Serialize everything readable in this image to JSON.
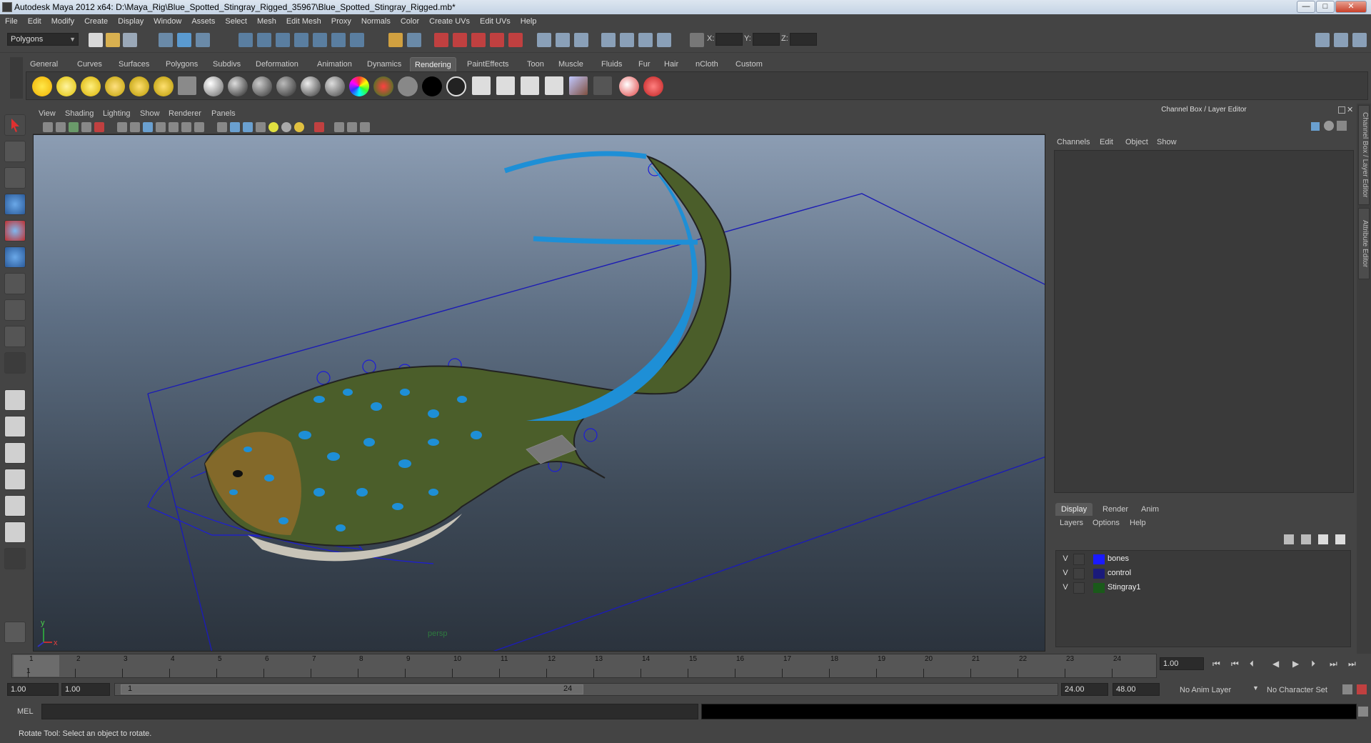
{
  "window": {
    "title": "Autodesk Maya 2012 x64: D:\\Maya_Rig\\Blue_Spotted_Stingray_Rigged_35967\\Blue_Spotted_Stingray_Rigged.mb*",
    "min": "—",
    "max": "□",
    "close": "✕"
  },
  "menubar": [
    "File",
    "Edit",
    "Modify",
    "Create",
    "Display",
    "Window",
    "Assets",
    "Select",
    "Mesh",
    "Edit Mesh",
    "Proxy",
    "Normals",
    "Color",
    "Create UVs",
    "Edit UVs",
    "Help"
  ],
  "toolbar": {
    "mode": "Polygons",
    "x_label": "X:",
    "y_label": "Y:",
    "z_label": "Z:"
  },
  "shelf_tabs": [
    "General",
    "Curves",
    "Surfaces",
    "Polygons",
    "Subdivs",
    "Deformation",
    "Animation",
    "Dynamics",
    "Rendering",
    "PaintEffects",
    "Toon",
    "Muscle",
    "Fluids",
    "Fur",
    "Hair",
    "nCloth",
    "Custom"
  ],
  "shelf_active": "Rendering",
  "viewport": {
    "menu": [
      "View",
      "Shading",
      "Lighting",
      "Show",
      "Renderer",
      "Panels"
    ],
    "camera_label": "persp",
    "axis_y": "y",
    "axis_x": "x"
  },
  "channel_box": {
    "title": "Channel Box / Layer Editor",
    "menu": [
      "Channels",
      "Edit",
      "Object",
      "Show"
    ]
  },
  "side_tabs": [
    "Channel Box / Layer Editor",
    "Attribute Editor"
  ],
  "layer_editor": {
    "tabs": [
      "Display",
      "Render",
      "Anim"
    ],
    "active_tab": "Display",
    "menu": [
      "Layers",
      "Options",
      "Help"
    ],
    "layers": [
      {
        "v": "V",
        "name": "bones",
        "color": "#1a1aff"
      },
      {
        "v": "V",
        "name": "control",
        "color": "#1a1a7a"
      },
      {
        "v": "V",
        "name": "Stingray1",
        "color": "#1a5a1a"
      }
    ]
  },
  "timeline": {
    "ticks": [
      "1",
      "2",
      "3",
      "4",
      "5",
      "6",
      "7",
      "8",
      "9",
      "10",
      "11",
      "12",
      "13",
      "14",
      "15",
      "16",
      "17",
      "18",
      "19",
      "20",
      "21",
      "22",
      "23",
      "24"
    ],
    "current_marker": "1",
    "current_frame": "1.00"
  },
  "range": {
    "start": "1.00",
    "playback_start": "1.00",
    "slider_start": "1",
    "slider_end": "24",
    "playback_end": "24.00",
    "end": "48.00",
    "anim_layer": "No Anim Layer",
    "character_set": "No Character Set"
  },
  "command": {
    "label": "MEL"
  },
  "status": "Rotate Tool: Select an object to rotate.",
  "colors": {
    "accent_blue": "#1e8fd6",
    "ray_green": "#4b5e2a",
    "wire": "#1c1cb4"
  }
}
